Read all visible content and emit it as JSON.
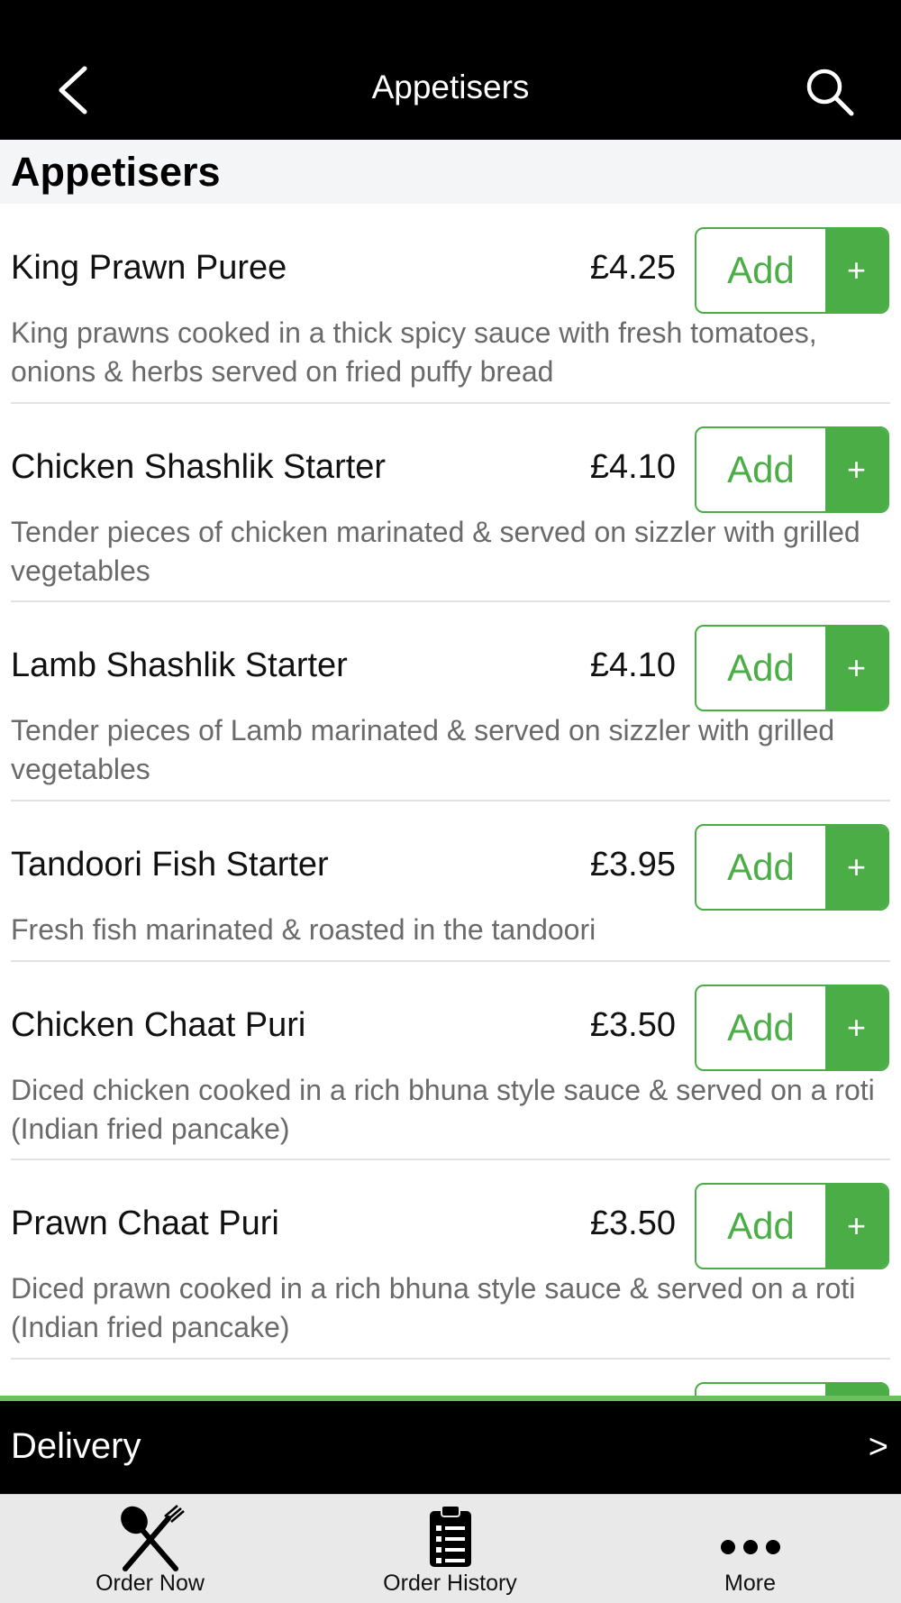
{
  "header": {
    "title": "Appetisers",
    "back_icon": "chevron-left-icon",
    "search_icon": "search-icon"
  },
  "section": {
    "title": "Appetisers"
  },
  "items": [
    {
      "name": "King Prawn Puree",
      "price": "£4.25",
      "add_label": "Add",
      "plus_label": "+",
      "description": "King prawns cooked in a thick spicy sauce with fresh tomatoes, onions & herbs served on fried puffy bread"
    },
    {
      "name": "Chicken Shashlik Starter",
      "price": "£4.10",
      "add_label": "Add",
      "plus_label": "+",
      "description": "Tender pieces of chicken marinated & served on sizzler with grilled vegetables"
    },
    {
      "name": "Lamb Shashlik Starter",
      "price": "£4.10",
      "add_label": "Add",
      "plus_label": "+",
      "description": "Tender pieces of Lamb marinated & served on sizzler with grilled vegetables"
    },
    {
      "name": "Tandoori Fish Starter",
      "price": "£3.95",
      "add_label": "Add",
      "plus_label": "+",
      "description": "Fresh fish marinated & roasted in the tandoori"
    },
    {
      "name": "Chicken Chaat Puri",
      "price": "£3.50",
      "add_label": "Add",
      "plus_label": "+",
      "description": "Diced chicken cooked in a rich bhuna style sauce & served on a roti (Indian fried pancake)"
    },
    {
      "name": "Prawn Chaat Puri",
      "price": "£3.50",
      "add_label": "Add",
      "plus_label": "+",
      "description": "Diced prawn cooked in a rich bhuna style sauce & served on a roti (Indian fried pancake)"
    }
  ],
  "delivery": {
    "label": "Delivery",
    "chevron": ">"
  },
  "tabs": [
    {
      "label": "Order Now",
      "icon": "fork-knife-icon"
    },
    {
      "label": "Order History",
      "icon": "clipboard-list-icon"
    },
    {
      "label": "More",
      "icon": "more-dots-icon"
    }
  ],
  "colors": {
    "accent": "#4aad45",
    "bar": "#000000",
    "tabbar": "#e9e9e9",
    "section_bg": "#f4f5f6"
  }
}
